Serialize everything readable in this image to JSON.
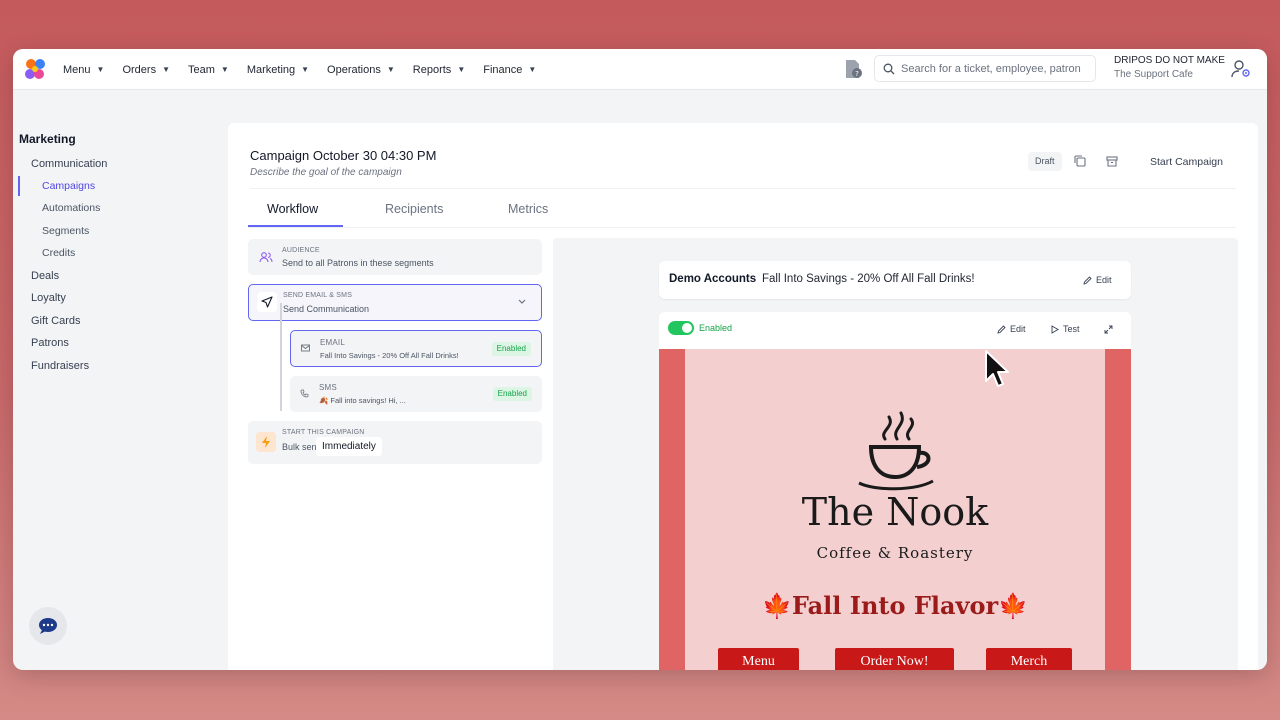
{
  "topbar": {
    "nav": [
      {
        "label": "Menu"
      },
      {
        "label": "Orders"
      },
      {
        "label": "Team"
      },
      {
        "label": "Marketing"
      },
      {
        "label": "Operations"
      },
      {
        "label": "Reports"
      },
      {
        "label": "Finance"
      }
    ],
    "search_placeholder": "Search for a ticket, employee, patron, p",
    "account_name": "DRIPOS DO NOT MAKE",
    "account_sub": "The Support Cafe"
  },
  "sidebar": {
    "title": "Marketing",
    "items": {
      "communication": "Communication",
      "campaigns": "Campaigns",
      "automations": "Automations",
      "segments": "Segments",
      "credits": "Credits",
      "deals": "Deals",
      "loyalty": "Loyalty",
      "gift_cards": "Gift Cards",
      "patrons": "Patrons",
      "fundraisers": "Fundraisers"
    }
  },
  "campaign": {
    "title": "Campaign October 30 04:30 PM",
    "description": "Describe the goal of the campaign",
    "status": "Draft",
    "start_label": "Start Campaign"
  },
  "tabs": [
    "Workflow",
    "Recipients",
    "Metrics"
  ],
  "workflow": {
    "audience": {
      "label": "AUDIENCE",
      "value": "Send to all Patrons in these segments"
    },
    "send": {
      "label": "SEND EMAIL & SMS",
      "value": "Send Communication"
    },
    "email": {
      "label": "EMAIL",
      "value": "Fall Into Savings - 20% Off All Fall Drinks!",
      "status": "Enabled"
    },
    "sms": {
      "label": "SMS",
      "value": "🍂 Fall into savings! Hi, ...",
      "status": "Enabled"
    },
    "start": {
      "label": "START THIS CAMPAIGN",
      "value": "Bulk send at",
      "timing": "Immediately"
    }
  },
  "preview": {
    "account": "Demo Accounts",
    "subject": "Fall Into Savings - 20% Off All Fall Drinks!",
    "edit_label": "Edit",
    "enabled_label": "Enabled",
    "test_label": "Test",
    "brand_name": "The Nook",
    "brand_sub": "Coffee & Roastery",
    "headline": "🍁Fall Into Flavor🍁",
    "buttons": [
      "Menu",
      "Order Now!",
      "Merch"
    ],
    "colors": {
      "frame": "#e06464",
      "panel": "#f3cfcf",
      "button": "#c81818",
      "headline": "#9b1b1b"
    }
  }
}
